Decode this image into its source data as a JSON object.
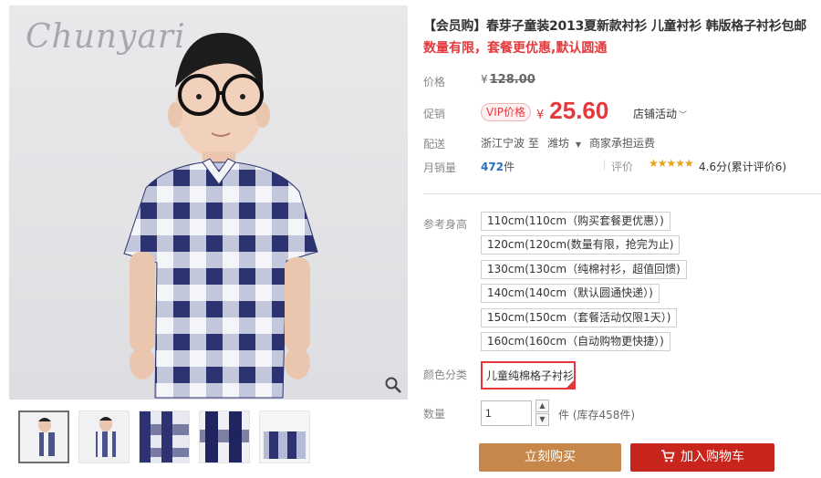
{
  "gallery": {
    "brand_watermark": "Chunyari",
    "thumbnails": [
      "thumb-1",
      "thumb-2",
      "thumb-3",
      "thumb-4",
      "thumb-5"
    ],
    "selected_thumbnail": 1
  },
  "product": {
    "title": "【会员购】春芽子童装2013夏新款衬衫 儿童衬衫 韩版格子衬衫包邮",
    "subtitle": "数量有限，套餐更优惠,默认圆通"
  },
  "price": {
    "label": "价格",
    "currency": "¥",
    "original": "128.00"
  },
  "promo": {
    "label": "促销",
    "vip_badge": "VIP价格",
    "currency": "¥",
    "price": "25.60",
    "store_activity": "店铺活动"
  },
  "shipping": {
    "label": "配送",
    "from": "浙江宁波 至",
    "to": "潍坊",
    "fee": "商家承担运费"
  },
  "sales": {
    "label": "月销量",
    "count": "472",
    "unit": "件",
    "rating_label": "评价",
    "stars": "★★★★★",
    "rating_text": "4.6分(累计评价6)"
  },
  "size": {
    "label": "参考身高",
    "options": [
      "110cm(110cm（购买套餐更优惠）)",
      "120cm(120cm(数量有限，抢完为止)",
      "130cm(130cm（纯棉衬衫，超值回馈)",
      "140cm(140cm（默认圆通快递）)",
      "150cm(150cm（套餐活动仅限1天）)",
      "160cm(160cm（自动购物更快捷）)"
    ]
  },
  "color": {
    "label": "颜色分类",
    "selected": "儿童纯棉格子衬衫"
  },
  "quantity": {
    "label": "数量",
    "value": "1",
    "unit_stock": "件 (库存458件)"
  },
  "actions": {
    "buy_now": "立刻购买",
    "add_to_cart": "加入购物车"
  },
  "colors": {
    "price_red": "#e4393c",
    "buy_button": "#c8874a",
    "cart_button": "#c8261c",
    "sales_blue": "#2a6fba"
  }
}
